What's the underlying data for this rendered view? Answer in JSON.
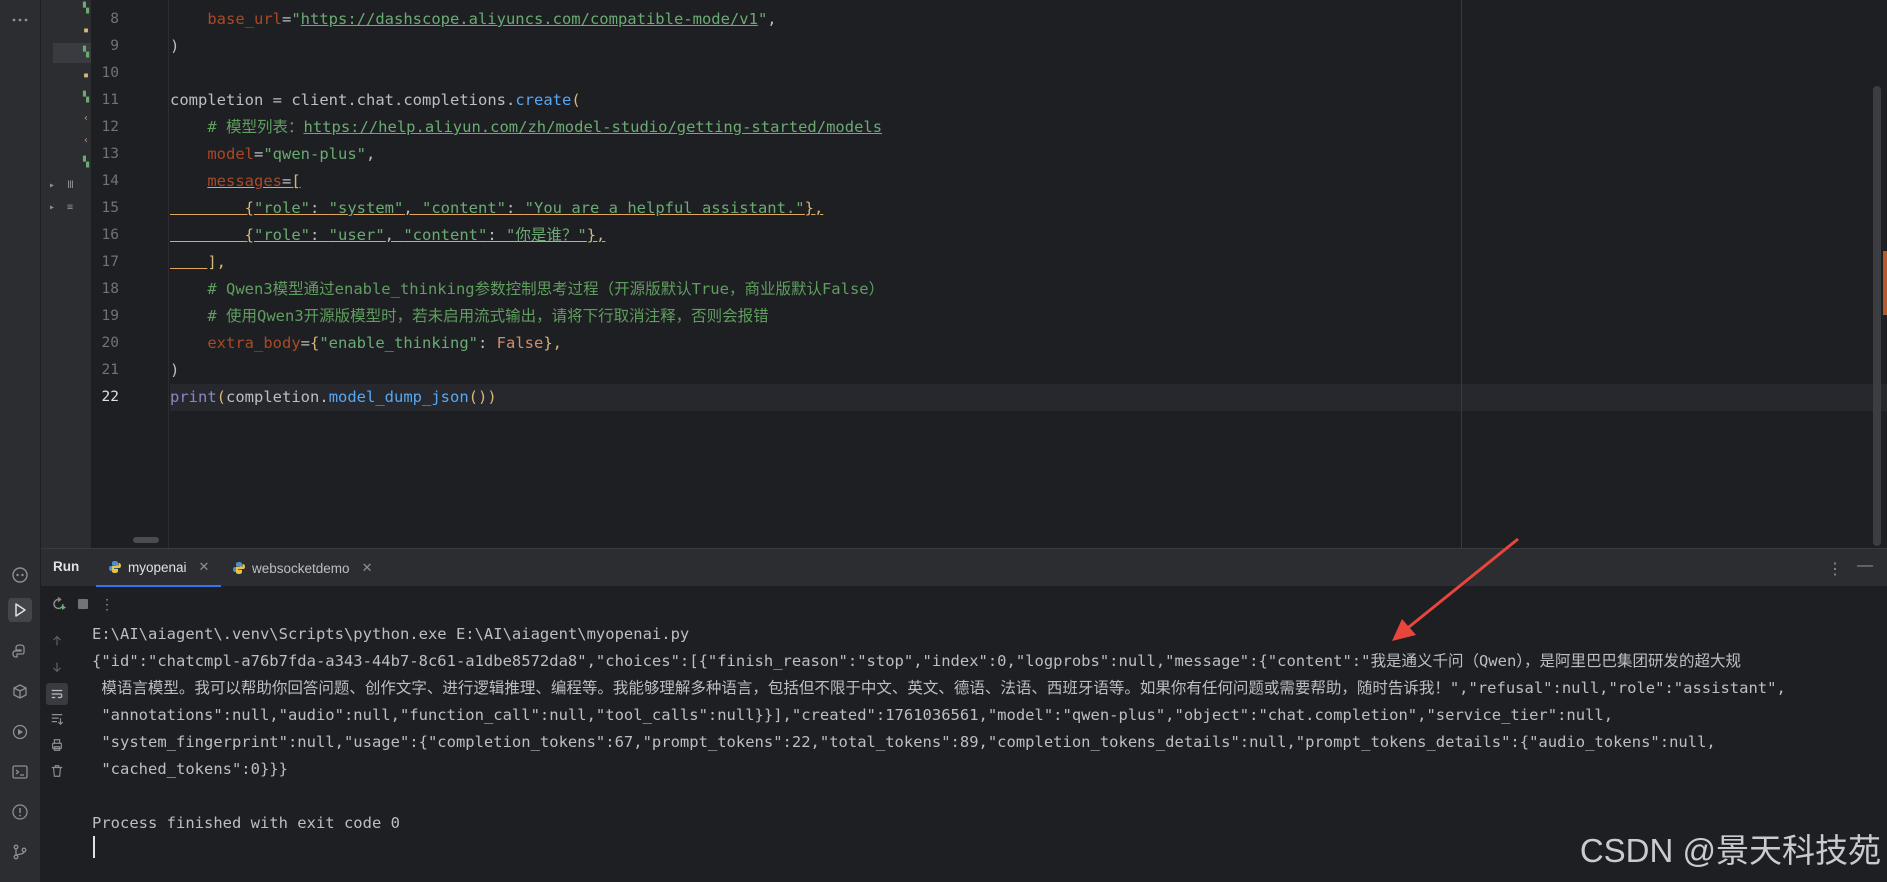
{
  "editor": {
    "line_numbers": [
      "8",
      "9",
      "10",
      "11",
      "12",
      "13",
      "14",
      "15",
      "16",
      "17",
      "18",
      "19",
      "20",
      "21",
      "22"
    ],
    "lines": {
      "l8": {
        "indent": "    ",
        "kw": "base_url",
        "eq": "=",
        "q1": "\"",
        "url": "https://dashscope.aliyuncs.com/compatible-mode/v1",
        "q2": "\"",
        "tail": ","
      },
      "l9": {
        "text": ")"
      },
      "l10": {
        "text": ""
      },
      "l11": {
        "a": "completion",
        "b": " = ",
        "c": "client",
        "d": ".",
        "e": "chat",
        "f": ".",
        "g": "completions",
        "h": ".",
        "i": "create",
        "j": "("
      },
      "l12": {
        "indent": "    ",
        "comment": "# 模型列表：",
        "url": "https://help.aliyun.com/zh/model-studio/getting-started/models"
      },
      "l13": {
        "indent": "    ",
        "kw": "model",
        "eq": "=",
        "str": "\"qwen-plus\"",
        "tail": ","
      },
      "l14": {
        "indent": "    ",
        "kw": "messages",
        "eq": "=",
        "br": "["
      },
      "l15": {
        "indent": "        ",
        "o": "{",
        "k1": "\"role\"",
        "c1": ": ",
        "v1": "\"system\"",
        "s1": ", ",
        "k2": "\"content\"",
        "c2": ": ",
        "v2": "\"You are a helpful assistant.\"",
        "cl": "},"
      },
      "l16": {
        "indent": "        ",
        "o": "{",
        "k1": "\"role\"",
        "c1": ": ",
        "v1": "\"user\"",
        "s1": ", ",
        "k2": "\"content\"",
        "c2": ": ",
        "v2": "\"你是谁？\"",
        "cl": "},"
      },
      "l17": {
        "indent": "    ",
        "text": "],"
      },
      "l18": {
        "indent": "    ",
        "comment": "# Qwen3模型通过enable_thinking参数控制思考过程（开源版默认True，商业版默认False）"
      },
      "l19": {
        "indent": "    ",
        "comment": "# 使用Qwen3开源版模型时，若未启用流式输出，请将下行取消注释，否则会报错"
      },
      "l20": {
        "indent": "    ",
        "kw": "extra_body",
        "eq": "=",
        "o": "{",
        "k": "\"enable_thinking\"",
        "c": ": ",
        "v": "False",
        "cl": "},"
      },
      "l21": {
        "text": ")"
      },
      "l22": {
        "fn": "print",
        "p1": "(",
        "a": "completion",
        "d": ".",
        "m": "model_dump_json",
        "p2": "())"
      }
    }
  },
  "run": {
    "title": "Run",
    "tabs": [
      {
        "label": "myopenai",
        "active": true
      },
      {
        "label": "websocketdemo",
        "active": false
      }
    ],
    "console": [
      "E:\\AI\\aiagent\\.venv\\Scripts\\python.exe E:\\AI\\aiagent\\myopenai.py",
      "{\"id\":\"chatcmpl-a76b7fda-a343-44b7-8c61-a1dbe8572da8\",\"choices\":[{\"finish_reason\":\"stop\",\"index\":0,\"logprobs\":null,\"message\":{\"content\":\"我是通义千问（Qwen），是阿里巴巴集团研发的超大规",
      " 模语言模型。我可以帮助你回答问题、创作文字、进行逻辑推理、编程等。我能够理解多种语言，包括但不限于中文、英文、德语、法语、西班牙语等。如果你有任何问题或需要帮助，随时告诉我！\",\"refusal\":null,\"role\":\"assistant\",",
      " \"annotations\":null,\"audio\":null,\"function_call\":null,\"tool_calls\":null}}],\"created\":1761036561,\"model\":\"qwen-plus\",\"object\":\"chat.completion\",\"service_tier\":null,",
      " \"system_fingerprint\":null,\"usage\":{\"completion_tokens\":67,\"prompt_tokens\":22,\"total_tokens\":89,\"completion_tokens_details\":null,\"prompt_tokens_details\":{\"audio_tokens\":null,",
      " \"cached_tokens\":0}}}",
      "",
      "Process finished with exit code 0"
    ]
  },
  "watermark": "CSDN @景天科技苑",
  "colors": {
    "background": "#1e1f22",
    "panel": "#2b2d30",
    "arrow": "#e8453c",
    "accent": "#3574f0"
  }
}
